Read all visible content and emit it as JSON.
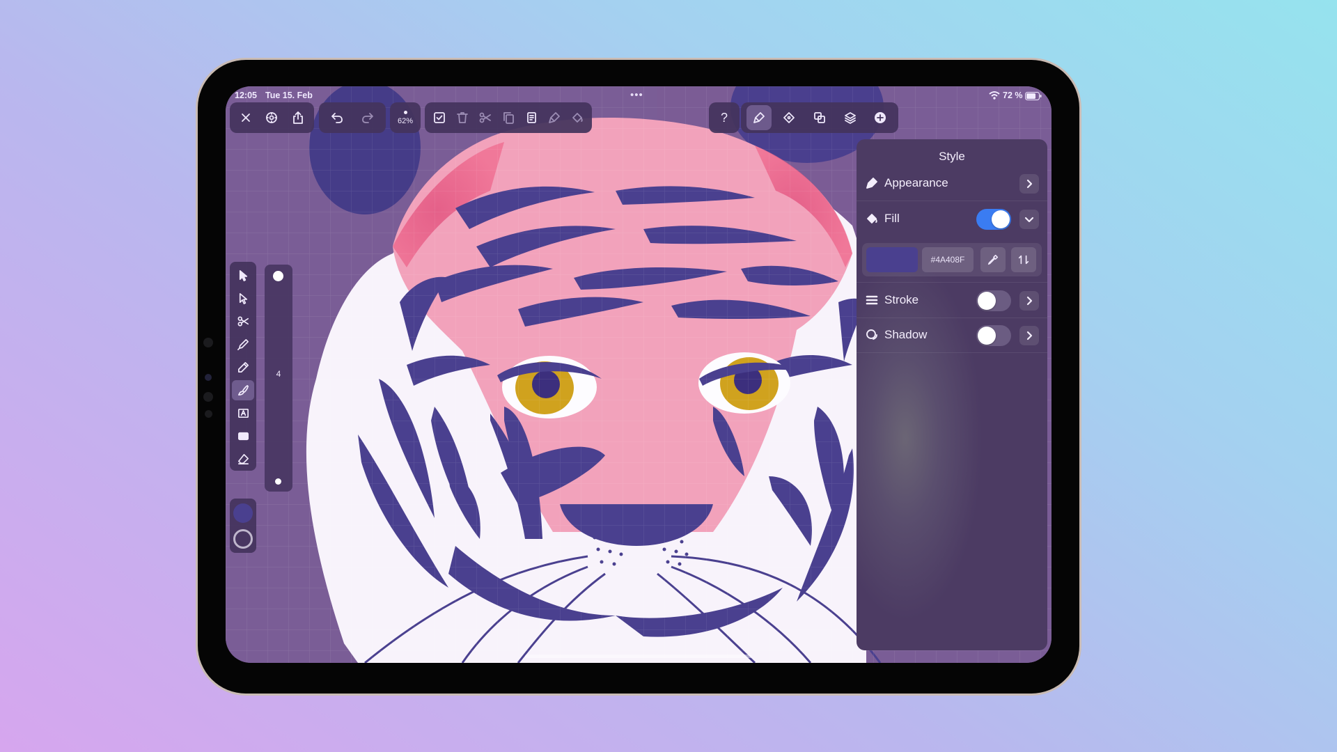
{
  "status_bar": {
    "time": "12:05",
    "date": "Tue 15. Feb",
    "battery": "72 %"
  },
  "toolbar": {
    "zoom": "62%"
  },
  "size_slider": {
    "value": "4"
  },
  "style_panel": {
    "title": "Style",
    "appearance_label": "Appearance",
    "fill_label": "Fill",
    "fill_enabled": true,
    "fill_color": "#4A408F",
    "fill_hex": "#4A408F",
    "stroke_label": "Stroke",
    "stroke_enabled": false,
    "shadow_label": "Shadow",
    "shadow_enabled": false
  },
  "colors": {
    "accent": "#3a7cf2",
    "canvas": "#7a5d96",
    "fill_swatch": "#4A408F"
  }
}
